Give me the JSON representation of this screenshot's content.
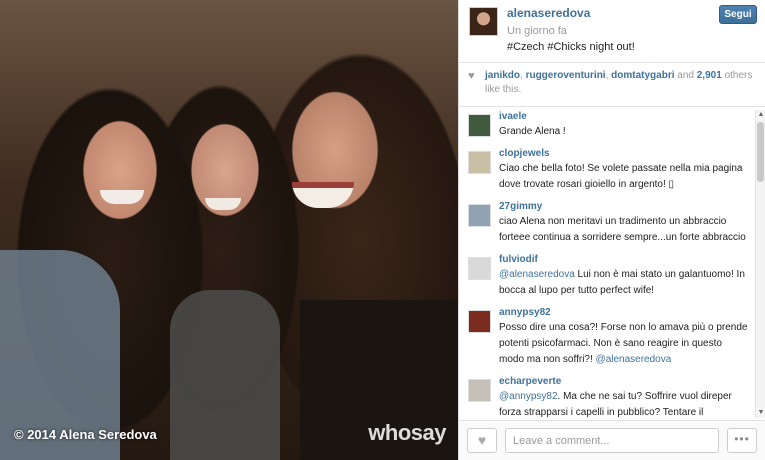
{
  "photo": {
    "copyright": "© 2014 Alena Seredova",
    "watermark": "whosay"
  },
  "post": {
    "username": "alenaseredova",
    "time": "Un giorno fa",
    "caption": "#Czech #Chicks night out!",
    "follow_label": "Segui"
  },
  "likes": {
    "users": [
      "janikdo",
      "ruggeroventurini",
      "domtatygabri"
    ],
    "and_label": "and",
    "count": "2,901",
    "suffix": "others like this."
  },
  "comments": [
    {
      "user": "ivaele",
      "text": "Grande Alena !",
      "avatar_color": "#3f5a3c"
    },
    {
      "user": "clopjewels",
      "text": "Ciao che bella foto! Se volete passate nella mia pagina dove trovate rosari gioiello in argento! ▯",
      "avatar_color": "#c9bfa5"
    },
    {
      "user": "27gimmy",
      "text": "ciao Alena non meritavi un tradimento un abbraccio forteee continua a sorridere sempre...un forte abbraccio",
      "avatar_color": "#8fa3b5"
    },
    {
      "user": "fulviodif",
      "mention": "@alenaseredova",
      "text": " Lui non è mai stato un galantuomo! In bocca al lupo per tutto perfect wife!",
      "avatar_color": "#d9d9d9"
    },
    {
      "user": "annypsy82",
      "text": "Posso dire una cosa?! Forse non lo amava più o prende potenti psicofarmaci. Non è sano reagire in questo modo ma non soffri?! ",
      "mention_end": "@alenaseredova",
      "avatar_color": "#7a2c1e"
    },
    {
      "user": "echarpeverte",
      "mention": "@annypsy82",
      "text": ". Ma che ne sai tu? Soffrire vuol direper forza strapparsi i capelli in pubblico? Tentare il",
      "avatar_color": "#c5c0b8"
    }
  ],
  "footer": {
    "comment_placeholder": "Leave a comment...",
    "more_label": "•••"
  },
  "icons": {
    "heart": "♥",
    "scroll_up": "▲",
    "scroll_down": "▼"
  }
}
